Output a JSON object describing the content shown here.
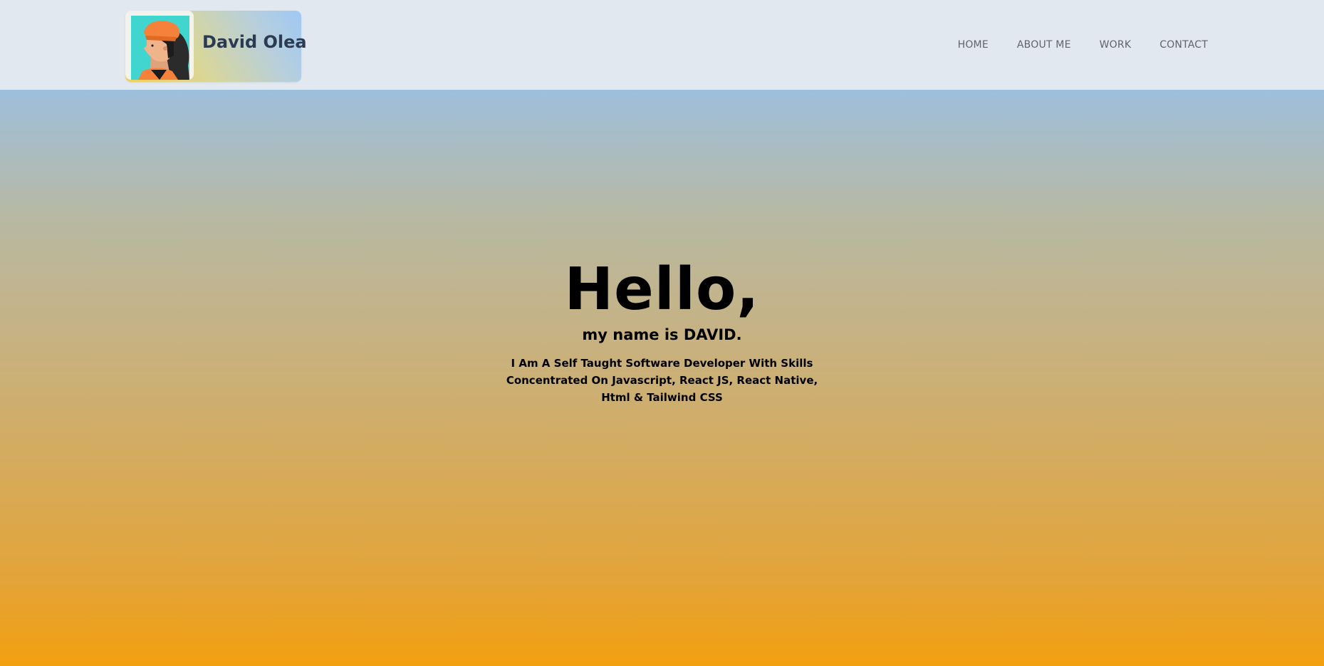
{
  "header": {
    "brand_name": "David Olea",
    "nav": [
      {
        "label": "HOME"
      },
      {
        "label": "ABOUT ME"
      },
      {
        "label": "WORK"
      },
      {
        "label": "CONTACT"
      }
    ]
  },
  "hero": {
    "title": "Hello,",
    "subtitle": "my name is DAVID.",
    "description": "I Am A Self Taught Software Developer With Skills Concentrated On Javascript, React JS, React Native, Html & Tailwind CSS"
  },
  "colors": {
    "header_bg": "#e2e8f0",
    "brand_text": "#2d3b52",
    "nav_text": "#5f6370",
    "hero_gradient_top": "#9ebfdc",
    "hero_gradient_bottom": "#f39f10"
  },
  "icons": {
    "avatar": "avatar-portrait-icon"
  }
}
